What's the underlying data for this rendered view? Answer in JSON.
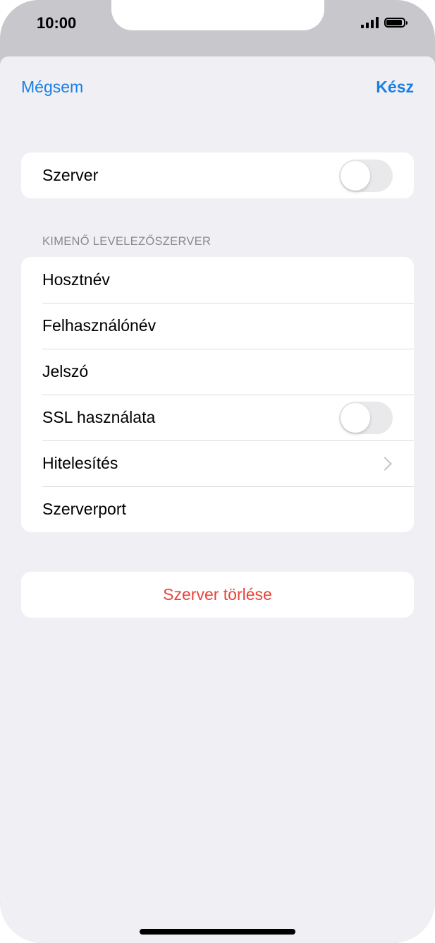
{
  "status_bar": {
    "time": "10:00"
  },
  "nav": {
    "cancel_label": "Mégsem",
    "done_label": "Kész"
  },
  "server_group": {
    "label": "Szerver",
    "toggle_on": false
  },
  "outgoing": {
    "header": "KIMENŐ LEVELEZŐSZERVER",
    "rows": [
      {
        "label": "Hosztnév"
      },
      {
        "label": "Felhasználónév"
      },
      {
        "label": "Jelszó"
      },
      {
        "label": "SSL használata",
        "toggle_on": false
      },
      {
        "label": "Hitelesítés"
      },
      {
        "label": "Szerverport"
      }
    ]
  },
  "delete_label": "Szerver törlése",
  "colors": {
    "accent": "#1a7fe3",
    "destructive": "#e8443a",
    "background": "#f0eff4"
  }
}
